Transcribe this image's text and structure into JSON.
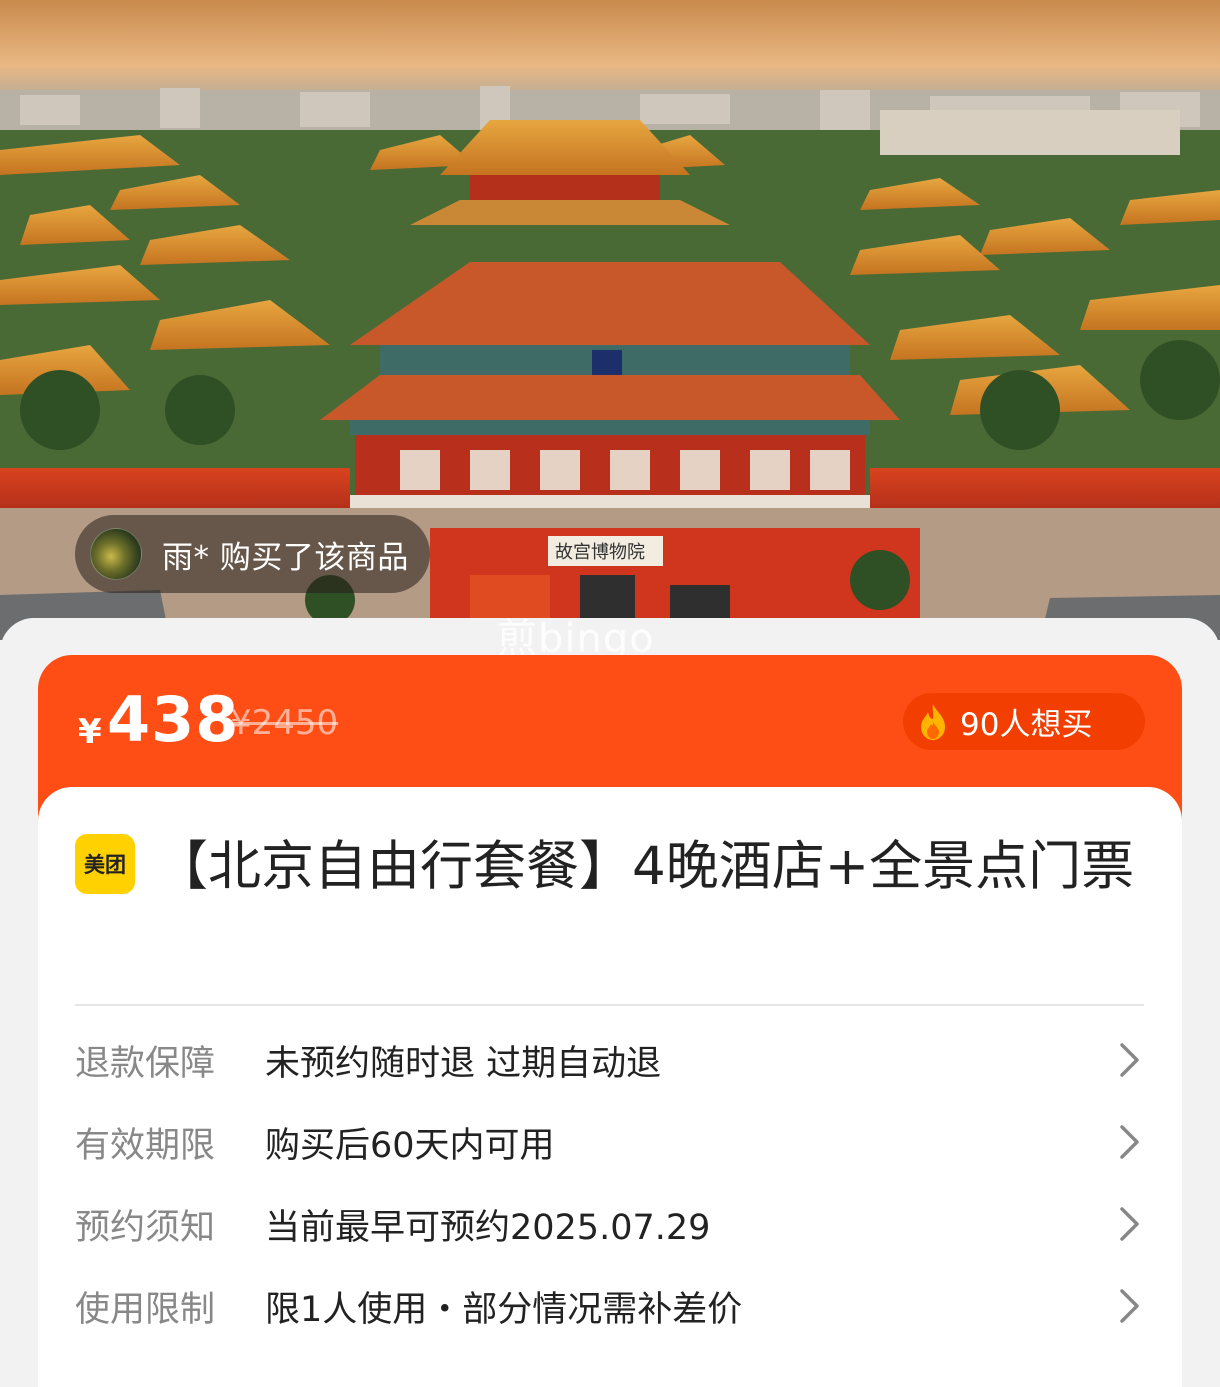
{
  "buyer": {
    "text": "雨* 购买了该商品"
  },
  "watermark": "煎bingo",
  "price": {
    "currency": "¥",
    "current": "438",
    "original": "¥2450",
    "want_count": "90人想买"
  },
  "product": {
    "brand": "美团",
    "title": "【北京自由行套餐】4晚酒店+全景点门票"
  },
  "details": [
    {
      "label": "退款保障",
      "value": "未预约随时退 过期自动退"
    },
    {
      "label": "有效期限",
      "value": "购买后60天内可用"
    },
    {
      "label": "预约须知",
      "value": "当前最早可预约2025.07.29"
    },
    {
      "label": "使用限制",
      "value": "限1人使用・部分情况需补差价"
    }
  ],
  "colors": {
    "accent": "#ff4e15",
    "badge": "#f23e00",
    "brand": "#ffd100"
  },
  "icons": {
    "fire": "fire-icon",
    "chevron": "chevron-right-icon"
  }
}
